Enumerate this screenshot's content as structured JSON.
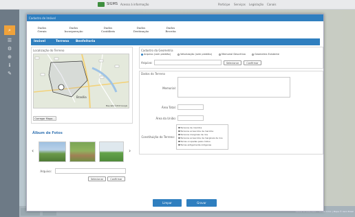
{
  "topbar": {
    "brand": "SIGMS",
    "menu": "Acesso à informação",
    "nav": [
      "Participe",
      "Serviços",
      "Legislação",
      "Canais"
    ]
  },
  "sidebar": {
    "icons": [
      "search-icon",
      "layers-icon",
      "settings-icon",
      "zoom-icon",
      "info-icon",
      "edit-icon"
    ]
  },
  "modal": {
    "header": "Cadastro de Imóvel",
    "steps": [
      {
        "l1": "Dados",
        "l2": "Gerais"
      },
      {
        "l1": "Dados",
        "l2": "Incorporação"
      },
      {
        "l1": "Dados",
        "l2": "Contábeis"
      },
      {
        "l1": "Dados",
        "l2": "Destinação"
      },
      {
        "l1": "Dados",
        "l2": "Receita"
      }
    ],
    "tabs": [
      "Imóvel",
      "Terreno",
      "Benfeitoria"
    ]
  },
  "location": {
    "title": "Localização do Terreno",
    "map_credit": "Map data ©2013 Google",
    "map_city": "Brasília",
    "button": "Carregar Mapa..."
  },
  "geometry": {
    "title": "Cadastro da Geometria",
    "options": [
      "Arquivo (com predião)",
      "Vetorização (sem predião)",
      "Memorial Descritivo",
      "Geometria Existente"
    ],
    "selected": 0,
    "file_label": "Arquivo:",
    "select_btn": "Selecionar",
    "confirm_btn": "Confirmar"
  },
  "land": {
    "title": "Dados do Terreno",
    "memorial_label": "Memorial:",
    "area_label": "Área Total:",
    "unit_label": "Área da União:",
    "constitution_label": "Constituição do Terreno:",
    "constitution_items": [
      "Terrenos de marinha",
      "Terrenos acrescidos de marinha",
      "Terrenos marginais de rios",
      "Terrenos acrescidos de marginais de rios",
      "Terras ocupadas pelos índios",
      "Terras antigamente indígenas"
    ]
  },
  "photos": {
    "title": "Álbum de Fotos",
    "file_label": "Arquivo:",
    "select_btn": "Selecionar",
    "confirm_btn": "Confirmar"
  },
  "footer_buttons": {
    "clear": "Limpar",
    "save": "Gravar"
  },
  "footer": {
    "credit": "Dados do IBGE/INDE - Versão 0.9.1 | Mapa © Aero Brasil"
  }
}
